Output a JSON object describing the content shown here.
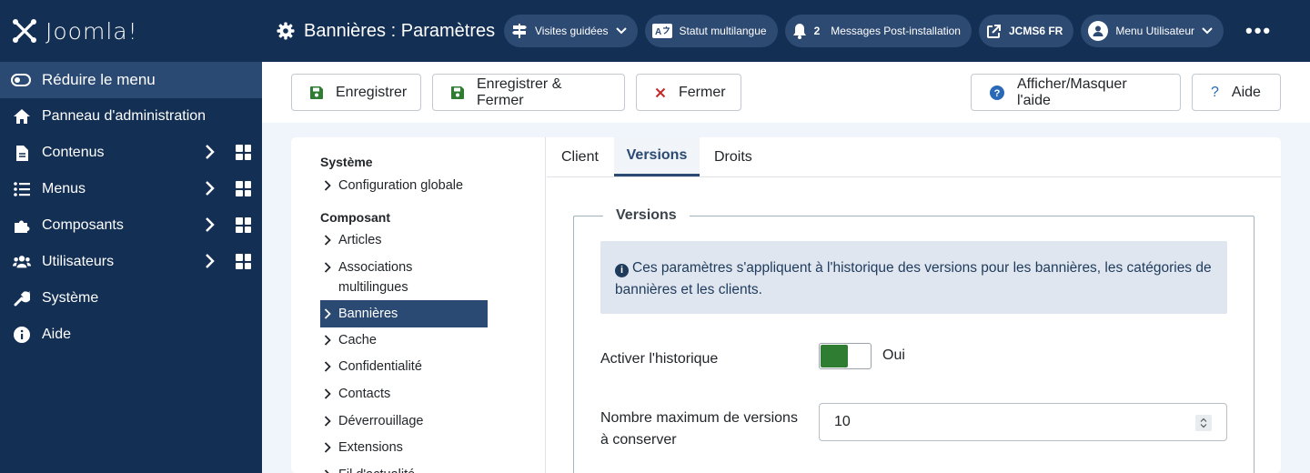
{
  "brand": {
    "logo_text": "Joomla!"
  },
  "sidebar": {
    "collapse_label": "Réduire le menu",
    "items": [
      {
        "label": "Panneau d'administration",
        "icon": "home-icon"
      },
      {
        "label": "Contenus",
        "icon": "file-icon"
      },
      {
        "label": "Menus",
        "icon": "list-icon"
      },
      {
        "label": "Composants",
        "icon": "puzzle-icon"
      },
      {
        "label": "Utilisateurs",
        "icon": "users-icon"
      },
      {
        "label": "Système",
        "icon": "wrench-icon"
      },
      {
        "label": "Aide",
        "icon": "info-icon"
      }
    ]
  },
  "header": {
    "title": "Bannières : Paramètres",
    "guided_tours": "Visites guidées",
    "multilang": "Statut multilangue",
    "messages_count": "2",
    "messages": "Messages Post-installation",
    "site": "JCMS6 FR",
    "user_menu": "Menu Utilisateur"
  },
  "toolbar": {
    "save": "Enregistrer",
    "save_close": "Enregistrer & Fermer",
    "close": "Fermer",
    "toggle_help": "Afficher/Masquer l'aide",
    "help": "Aide"
  },
  "leftnav": {
    "system_title": "Système",
    "global_config": "Configuration globale",
    "component_title": "Composant",
    "links": [
      "Articles",
      "Associations multilingues",
      "Bannières",
      "Cache",
      "Confidentialité",
      "Contacts",
      "Déverrouillage",
      "Extensions",
      "Fil d'actualité"
    ],
    "active": "Bannières"
  },
  "tabs": [
    "Client",
    "Versions",
    "Droits"
  ],
  "active_tab": "Versions",
  "versions": {
    "legend": "Versions",
    "info": "Ces paramètres s'appliquent à l'historique des versions pour les bannières, les catégories de bannières et les clients.",
    "history_label": "Activer l'historique",
    "history_value": "Oui",
    "history_enabled": true,
    "max_versions_label": "Nombre maximum de versions à conserver",
    "max_versions_value": "10"
  },
  "colors": {
    "sidebar": "#132f53",
    "accent": "#2a4a73",
    "switch_on": "#2e7d32",
    "save_icon": "#2e7d32",
    "close_icon": "#c52827",
    "help_icon": "#2a69b8"
  }
}
